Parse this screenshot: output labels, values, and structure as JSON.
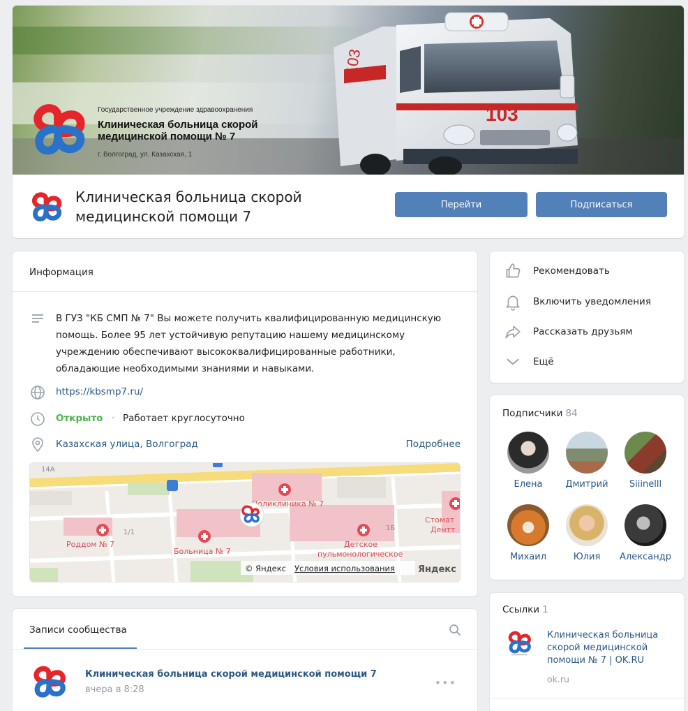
{
  "header": {
    "cover": {
      "org_type": "Государственное учреждение здравоохранения",
      "org_name": "Клиническая больница скорой медицинской помощи № 7",
      "address": "г. Волгоград, ул. Казахская, 1",
      "ambulance_number": "103"
    },
    "title": "Клиническая больница скорой медицинской помощи 7",
    "go_button": "Перейти",
    "subscribe_button": "Подписаться"
  },
  "info": {
    "title": "Информация",
    "description": "В ГУЗ \"КБ СМП № 7\" Вы можете получить квалифицированную медицинскую помощь. Более 95 лет устойчивую репутацию нашему медицинскому учреждению обеспечивают высококвалифицированные работники, обладающие необходимыми знаниями и навыками.",
    "website": "https://kbsmp7.ru/",
    "status": "Открыто",
    "status_separator": "·",
    "hours": "Работает круглосуточно",
    "address": "Казахская улица, Волгоград",
    "more": "Подробнее",
    "map": {
      "labels": {
        "polyclinic": "Поликлиника № 7",
        "maternity": "Роддом № 7",
        "hospital": "Больница № 7",
        "pulmo_line1": "Детское",
        "pulmo_line2": "пульмонологическое",
        "stomat_line1": "Стомат",
        "stomat_line2": "Дентт",
        "house_14a": "14А",
        "house_1_1": "1/1",
        "house_1b": "1Б"
      },
      "copyright": "© Яндекс",
      "terms": "Условия использования",
      "brand": "Яндекс"
    }
  },
  "posts": {
    "tab": "Записи сообщества",
    "author": "Клиническая больница скорой медицинской помощи 7",
    "time": "вчера в 8:28",
    "more": "•••"
  },
  "actions": [
    {
      "label": "Рекомендовать",
      "icon": "like-icon"
    },
    {
      "label": "Включить уведомления",
      "icon": "bell-icon"
    },
    {
      "label": "Рассказать друзьям",
      "icon": "share-icon"
    },
    {
      "label": "Ещё",
      "icon": "chevron-down-icon"
    }
  ],
  "subscribers": {
    "title": "Подписчики",
    "count": "84",
    "members": [
      {
        "name": "Елена"
      },
      {
        "name": "Дмитрий"
      },
      {
        "name": "Siiinelll"
      },
      {
        "name": "Михаил"
      },
      {
        "name": "Юлия"
      },
      {
        "name": "Александр"
      }
    ]
  },
  "links": {
    "title": "Ссылки",
    "count": "1",
    "item_title": "Клиническая больница скорой медицинской помощи № 7 | OK.RU",
    "item_domain": "ok.ru"
  },
  "colors": {
    "accent": "#5181b8",
    "link": "#2a5885",
    "open_status": "#4bb34b",
    "logo_red": "#e4262a",
    "logo_blue": "#2a72c8"
  }
}
